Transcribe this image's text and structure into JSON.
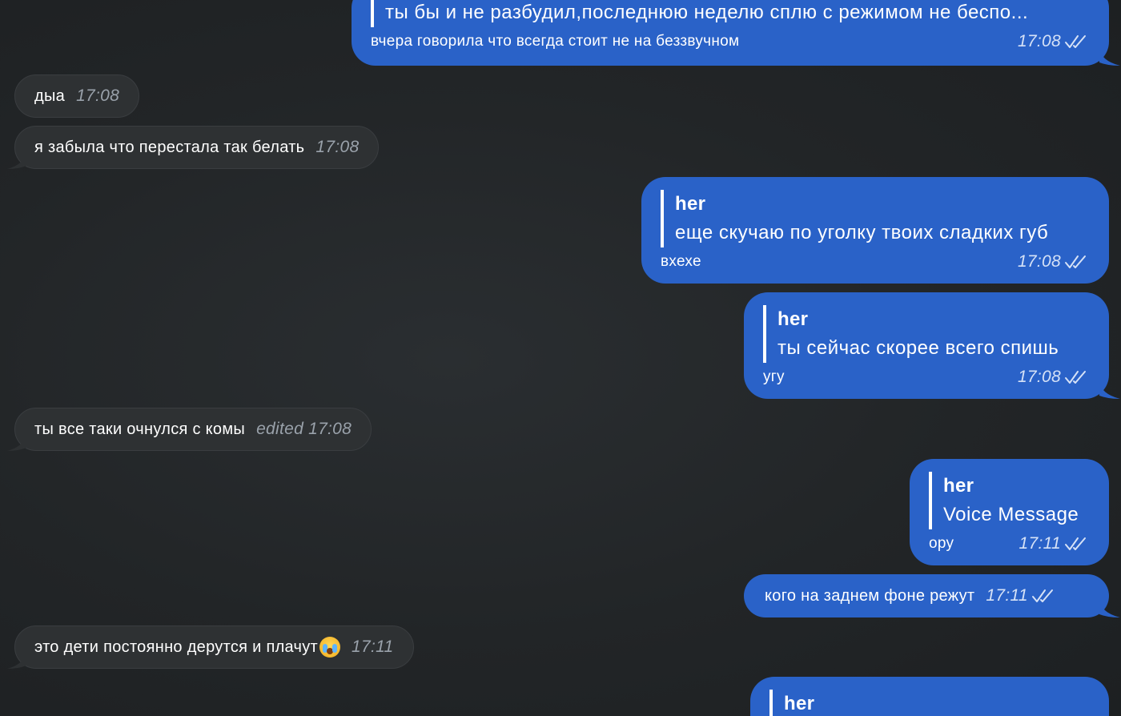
{
  "messages": {
    "m1": {
      "quote_text": "ты бы и не разбудил,последнюю неделю сплю с режимом не беспо...",
      "text": "вчера говорила что всегда стоит не на беззвучном",
      "time": "17:08"
    },
    "m2": {
      "text": "дыа",
      "time": "17:08"
    },
    "m3": {
      "text": "я забыла что перестала так белать",
      "time": "17:08"
    },
    "m4": {
      "quote_author": "her",
      "quote_text": "еще скучаю по уголку твоих сладких губ",
      "text": "вхехе",
      "time": "17:08"
    },
    "m5": {
      "quote_author": "her",
      "quote_text": "ты сейчас скорее всего спишь",
      "text": "угу",
      "time": "17:08"
    },
    "m6": {
      "text": "ты все таки очнулся с комы",
      "edited": "edited",
      "time": "17:08"
    },
    "m7": {
      "quote_author": "her",
      "quote_text": "Voice Message",
      "text": "ору",
      "time": "17:11"
    },
    "m8": {
      "text": "кого на заднем фоне режут",
      "time": "17:11"
    },
    "m9": {
      "text": "это дети постоянно дерутся и плачут",
      "time": "17:11"
    },
    "m10": {
      "quote_author": "her"
    }
  },
  "icons": {
    "read_receipt": "double-check-icon",
    "emoji": "loudly-crying-face-emoji"
  },
  "colors": {
    "outgoing_bubble": "#2a62c8",
    "incoming_bubble": "#2e3133",
    "background": "#222527"
  }
}
